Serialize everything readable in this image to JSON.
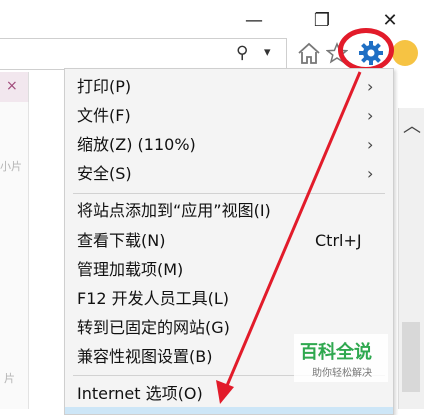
{
  "window": {
    "minimize_glyph": "—",
    "restore_glyph": "❐",
    "close_glyph": "✕"
  },
  "address": {
    "search_glyph": "⚲",
    "dropdown_glyph": "▾"
  },
  "tab": {
    "close_glyph": "×"
  },
  "left_fragments": [
    "小片",
    "片"
  ],
  "menu": {
    "items": [
      {
        "label": "打印(P)",
        "submenu": true
      },
      {
        "label": "文件(F)",
        "submenu": true
      },
      {
        "label": "缩放(Z) (110%)",
        "submenu": true
      },
      {
        "label": "安全(S)",
        "submenu": true
      },
      {
        "label": "将站点添加到“应用”视图(I)",
        "submenu": false
      },
      {
        "label": "查看下载(N)",
        "submenu": false,
        "shortcut": "Ctrl+J"
      },
      {
        "label": "管理加载项(M)",
        "submenu": false
      },
      {
        "label": "F12 开发人员工具(L)",
        "submenu": false
      },
      {
        "label": "转到已固定的网站(G)",
        "submenu": false
      },
      {
        "label": "兼容性视图设置(B)",
        "submenu": false
      },
      {
        "label": "Internet 选项(O)",
        "submenu": false
      }
    ],
    "submenu_glyph": "›"
  },
  "watermark": {
    "title": "百科全说",
    "subtitle": "助你轻松解决"
  },
  "colors": {
    "annotation_red": "#e21b2a",
    "gear_blue": "#1f6fc4",
    "baike_green": "#2fa84f"
  },
  "icons": [
    "home-icon",
    "favorites-star-icon",
    "gear-icon",
    "smiley-icon",
    "search-icon"
  ]
}
